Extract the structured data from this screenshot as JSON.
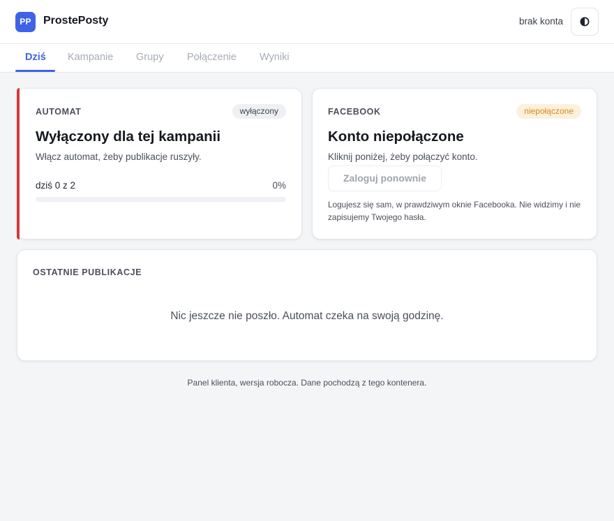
{
  "app": {
    "logo_text": "PP",
    "title": "ProstePosty",
    "account_status": "brak konta",
    "accent_color": "#3f63e6"
  },
  "tabs": [
    {
      "label": "Dziś",
      "active": true
    },
    {
      "label": "Kampanie",
      "active": false
    },
    {
      "label": "Grupy",
      "active": false
    },
    {
      "label": "Połączenie",
      "active": false
    },
    {
      "label": "Wyniki",
      "active": false
    }
  ],
  "automat": {
    "kicker": "AUTOMAT",
    "badge": "wyłączony",
    "title": "Wyłączony dla tej kampanii",
    "subtitle": "Włącz automat, żeby publikacje ruszyły.",
    "progress_label": "dziś 0 z 2",
    "progress_percent": "0%",
    "progress_value": 0,
    "status_color": "#d33a3a"
  },
  "facebook": {
    "kicker": "FACEBOOK",
    "badge": "niepołączone",
    "title": "Konto niepołączone",
    "subtitle": "Kliknij poniżej, żeby połączyć konto.",
    "relogin_label": "Zaloguj ponownie",
    "note": "Logujesz się sam, w prawdziwym oknie Facebooka. Nie widzimy i nie zapisujemy Twojego hasła.",
    "badge_color": "#d9861a"
  },
  "recent": {
    "kicker": "OSTATNIE PUBLIKACJE",
    "empty_message": "Nic jeszcze nie poszło. Automat czeka na swoją godzinę."
  },
  "footer": {
    "text": "Panel klienta, wersja robocza. Dane pochodzą z tego kontenera."
  },
  "icons": {
    "theme_toggle": "half-circle-contrast-icon"
  }
}
